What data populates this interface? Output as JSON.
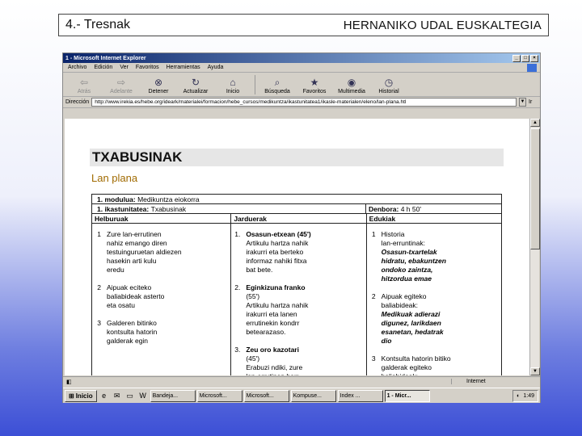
{
  "slide": {
    "left_title": "4.- Tresnak",
    "right_title": "HERNANIKO UDAL EUSKALTEGIA"
  },
  "browser": {
    "window_title": "1 - Microsoft Internet Explorer",
    "menu": [
      "Archivo",
      "Edición",
      "Ver",
      "Favoritos",
      "Herramientas",
      "Ayuda"
    ],
    "toolbar": [
      "Atrás",
      "Adelante",
      "Detener",
      "Actualizar",
      "Inicio",
      "Búsqueda",
      "Favoritos",
      "Multimedia",
      "Historial"
    ],
    "address_label": "Dirección",
    "address_url": "http://www.irekia.es/hebe.org/ideark/materialei/formacion/hebe_cursos/medikuntza/ikastunitatea1/ikasle-materialen/eleno/lan-plana.htl",
    "go_label": "Ir",
    "status_left": "",
    "status_zone": "Internet"
  },
  "page": {
    "title": "TXABUSINAK",
    "subtitle": "Lan plana",
    "row1_label": "1. modulua:",
    "row1_value": "Medikuntza eiokorra",
    "row2_label": "1. ikastunitatea:",
    "row2_value": "Txabusinak",
    "duration_label": "Denbora:",
    "duration_value": "4 h 50'",
    "headers": [
      "Helburuak",
      "Jarduerak",
      "Edukiak"
    ],
    "helburuak": [
      {
        "n": "1",
        "lines": [
          "Zure lan-errutinen",
          "nahiz emango diren",
          "testuinguruetan aldiezen",
          "hasekin arti kulu",
          "eredu"
        ]
      },
      {
        "n": "2",
        "lines": [
          "Aipuak eciteko",
          "baliabideak asterto",
          "eta osatu"
        ]
      },
      {
        "n": "3",
        "lines": [
          "Galderen bitinko",
          "kontsulta hatorin",
          "galderak egin"
        ]
      }
    ],
    "jarduerak": [
      {
        "n": "1.",
        "bold": "Osasun-etxean (45')",
        "lines": [
          "Artikulu hartza nahik",
          "irakurri eta berteko",
          "informaz nahiki fitxa",
          "bat bete."
        ]
      },
      {
        "n": "2.",
        "bold": "Eginkizuna franko",
        "lines": [
          "(55')",
          "Artikulu hartza nahik",
          "irakurri eta lanen",
          "errutinekin kondrr",
          "betearazaso."
        ]
      },
      {
        "n": "3.",
        "bold": "Zeu oro kazotari",
        "lines": [
          "(45')",
          "Erabuzi ndiki, zure",
          "lan-errutinen berr"
        ]
      }
    ],
    "edukiak": [
      {
        "n": "1",
        "lines": [
          "Historia",
          "lan-erruntinak:"
        ],
        "bi": [
          "Osasun-txartelak",
          "hidratu, ebakuntzen",
          "ondoko zaintza,",
          "hitzordua emae"
        ]
      },
      {
        "n": "2",
        "lines": [
          "Aipuak egiteko",
          "baliabideak:"
        ],
        "bi": [
          "Medikuak adierazi",
          "digunez, larikdaen",
          "esanetan, hedatrak",
          "dio"
        ]
      },
      {
        "n": "3",
        "lines": [
          "Kontsulta hatorin bitiko",
          "galderak egiteko",
          "baliabideak:"
        ],
        "bi": []
      }
    ]
  },
  "taskbar": {
    "start_label": "Inicio",
    "tasks": [
      "Bandeja...",
      "Microsoft...",
      "Microsoft...",
      "Kompuse...",
      "Index ...",
      "1 - Micr..."
    ],
    "clock": "1:49"
  }
}
